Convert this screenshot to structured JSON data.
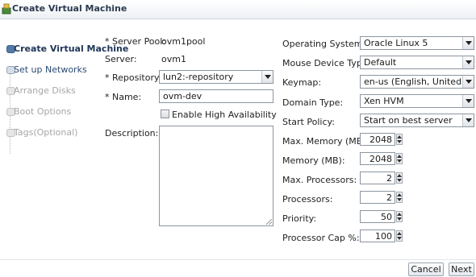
{
  "window": {
    "title": "Create Virtual Machine"
  },
  "train": {
    "steps": [
      {
        "label": "Create Virtual Machine",
        "state": "active"
      },
      {
        "label": "Set up Networks",
        "state": "next"
      },
      {
        "label": "Arrange Disks",
        "state": "disabled"
      },
      {
        "label": "Boot Options",
        "state": "disabled"
      },
      {
        "label": "Tags(Optional)",
        "state": "disabled"
      }
    ]
  },
  "left_form": {
    "server_pool_label": "* Server Pool:",
    "server_pool_value": "ovm1pool",
    "server_label": "Server:",
    "server_value": "ovm1",
    "repository_label": "* Repository:",
    "repository_value": "lun2:-repository",
    "name_label": "* Name:",
    "name_value": "ovm-dev",
    "ha_label": "Enable High Availability",
    "ha_checked": false,
    "description_label": "Description:",
    "description_value": ""
  },
  "right_form": {
    "os_label": "Operating System:",
    "os_value": "Oracle Linux 5",
    "mouse_label": "Mouse Device Type:",
    "mouse_value": "Default",
    "keymap_label": "Keymap:",
    "keymap_value": "en-us (English, United States)",
    "domain_label": "Domain Type:",
    "domain_value": "Xen HVM",
    "start_policy_label": "Start Policy:",
    "start_policy_value": "Start on best server",
    "max_memory_label": "Max. Memory (MB):",
    "max_memory_value": "2048",
    "memory_label": "Memory (MB):",
    "memory_value": "2048",
    "max_processors_label": "Max. Processors:",
    "max_processors_value": "2",
    "processors_label": "Processors:",
    "processors_value": "2",
    "priority_label": "Priority:",
    "priority_value": "50",
    "cap_label": "Processor Cap %:",
    "cap_value": "100"
  },
  "footer": {
    "cancel_label": "Cancel",
    "next_label": "Next"
  },
  "colors": {
    "active_step": "#5379a6",
    "title_text": "#2b3a4f"
  }
}
